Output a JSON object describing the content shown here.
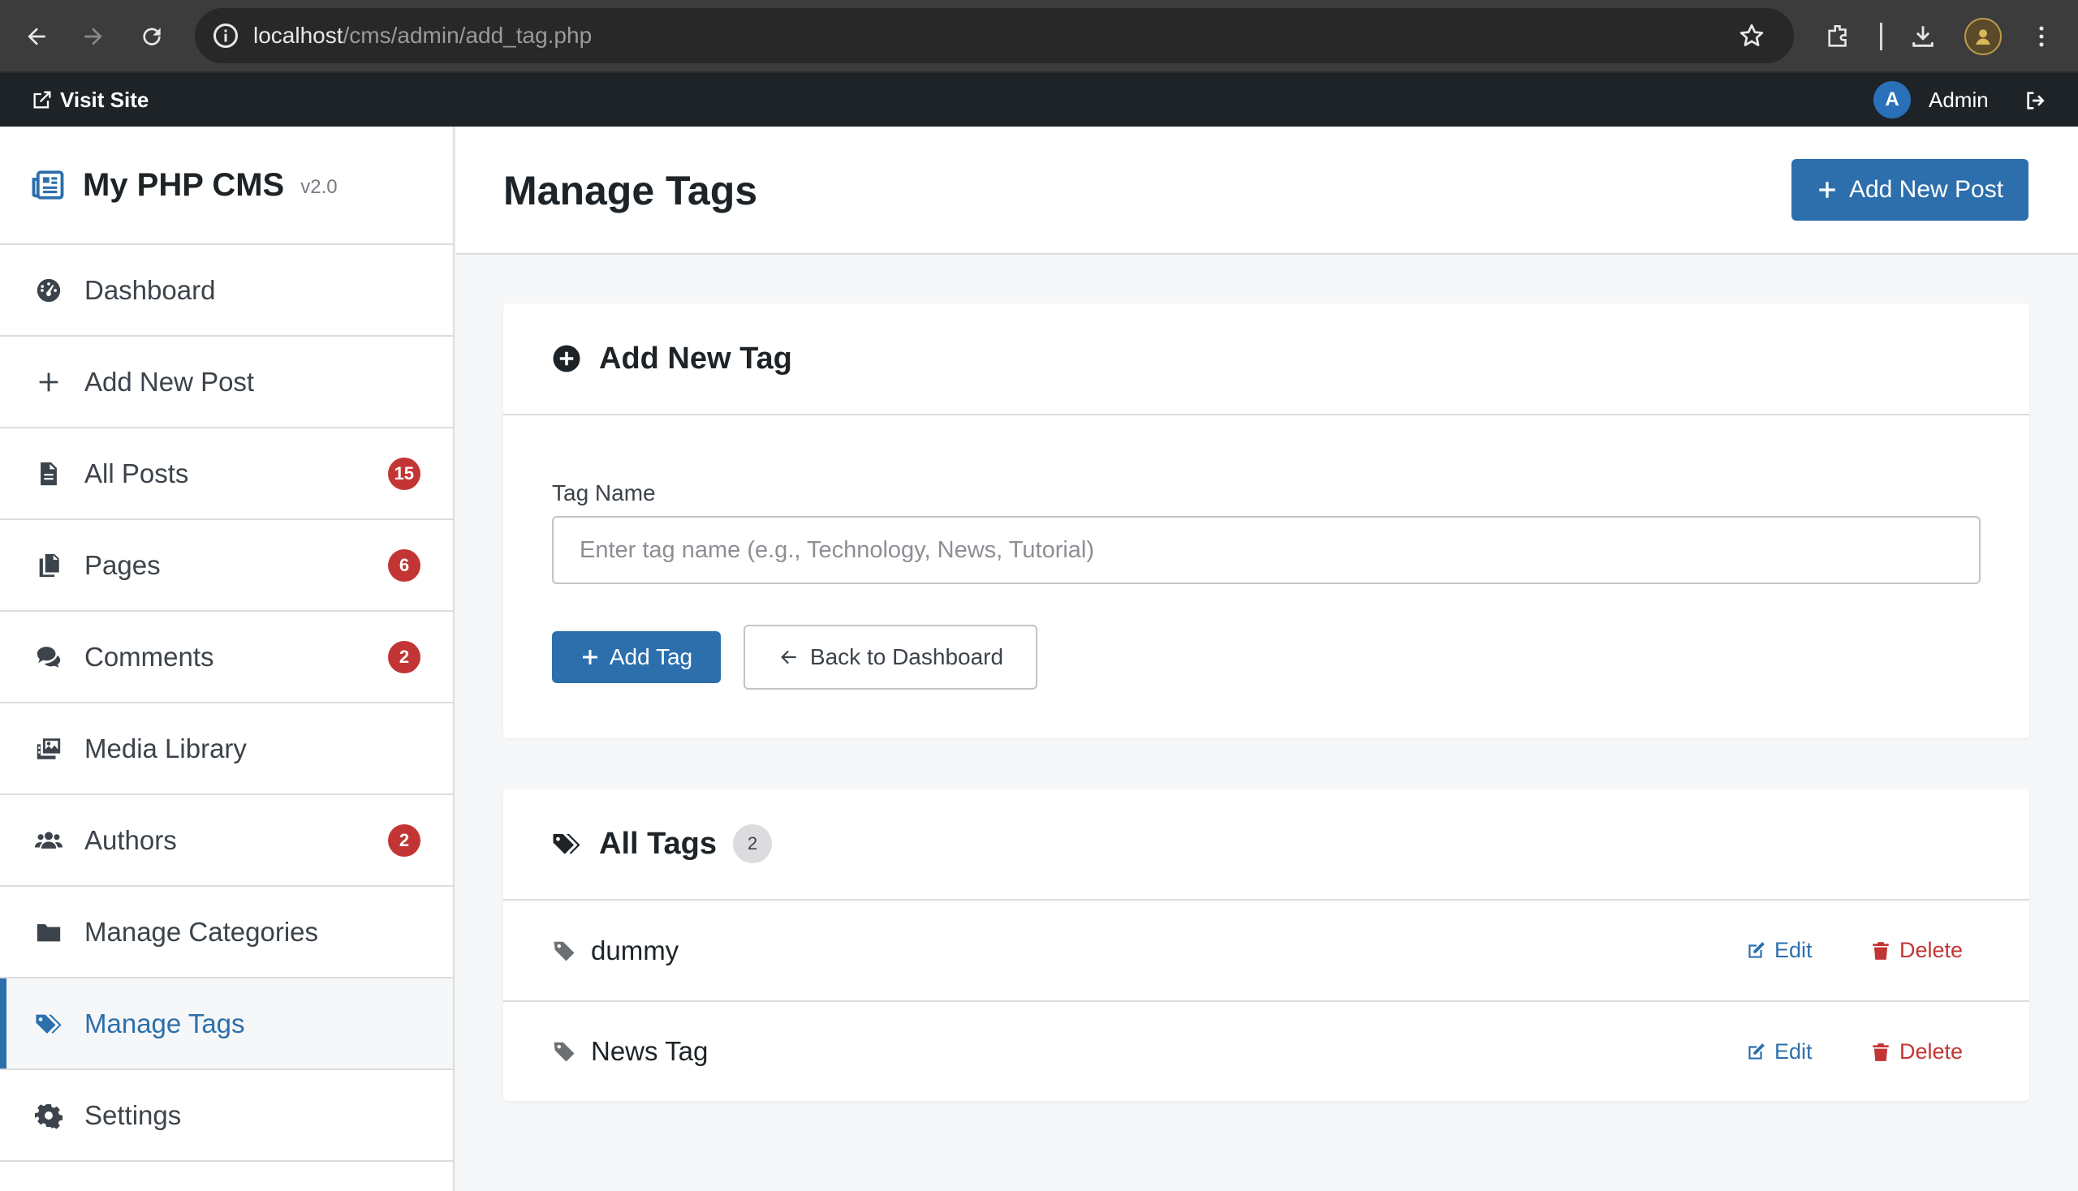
{
  "browser": {
    "url_host": "localhost",
    "url_path": "/cms/admin/add_tag.php"
  },
  "adminbar": {
    "visit_site": "Visit Site",
    "avatar_initial": "A",
    "user_name": "Admin"
  },
  "sidebar": {
    "brand_title": "My PHP CMS",
    "brand_version": "v2.0",
    "items": [
      {
        "label": "Dashboard",
        "icon": "gauge-icon"
      },
      {
        "label": "Add New Post",
        "icon": "plus-icon"
      },
      {
        "label": "All Posts",
        "icon": "file-icon",
        "badge": "15"
      },
      {
        "label": "Pages",
        "icon": "copy-icon",
        "badge": "6"
      },
      {
        "label": "Comments",
        "icon": "comments-icon",
        "badge": "2"
      },
      {
        "label": "Media Library",
        "icon": "photo-film-icon"
      },
      {
        "label": "Authors",
        "icon": "users-icon",
        "badge": "2"
      },
      {
        "label": "Manage Categories",
        "icon": "folder-icon"
      },
      {
        "label": "Manage Tags",
        "icon": "tags-icon",
        "active": true
      },
      {
        "label": "Settings",
        "icon": "gear-icon"
      }
    ]
  },
  "header": {
    "title": "Manage Tags",
    "add_post_label": "Add New Post"
  },
  "add_tag": {
    "heading": "Add New Tag",
    "field_label": "Tag Name",
    "placeholder": "Enter tag name (e.g., Technology, News, Tutorial)",
    "value": "",
    "submit_label": "Add Tag",
    "back_label": "Back to Dashboard"
  },
  "all_tags": {
    "heading": "All Tags",
    "count": "2",
    "edit_label": "Edit",
    "delete_label": "Delete",
    "tags": [
      {
        "name": "dummy"
      },
      {
        "name": "News Tag"
      }
    ]
  },
  "colors": {
    "primary": "#2c6fac",
    "danger": "#c33534",
    "admin_bar": "#1d2327"
  }
}
